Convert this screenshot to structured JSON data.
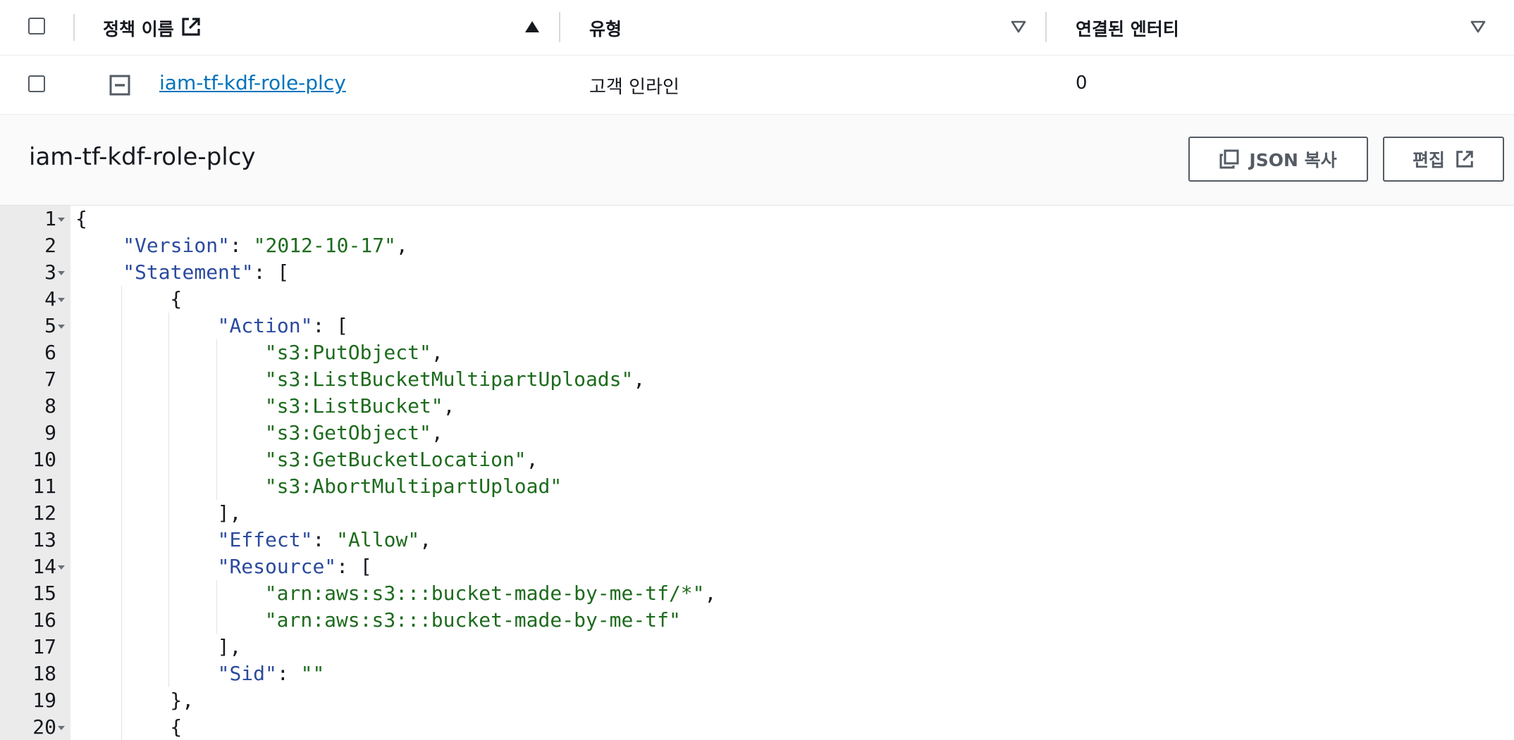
{
  "table": {
    "headers": {
      "policy_name": "정책 이름",
      "type": "유형",
      "attached_entities": "연결된 엔터티"
    },
    "rows": [
      {
        "name": "iam-tf-kdf-role-plcy",
        "type": "고객 인라인",
        "attached": "0"
      }
    ]
  },
  "detail": {
    "title": "iam-tf-kdf-role-plcy",
    "copy_json_label": "JSON 복사",
    "edit_label": "편집"
  },
  "editor": {
    "lines": [
      [
        [
          "p",
          "{"
        ]
      ],
      [
        [
          "k",
          "\"Version\""
        ],
        [
          "p",
          ": "
        ],
        [
          "s",
          "\"2012-10-17\""
        ],
        [
          "p",
          ","
        ]
      ],
      [
        [
          "k",
          "\"Statement\""
        ],
        [
          "p",
          ": ["
        ]
      ],
      [
        [
          "p",
          "{"
        ]
      ],
      [
        [
          "k",
          "\"Action\""
        ],
        [
          "p",
          ": ["
        ]
      ],
      [
        [
          "s",
          "\"s3:PutObject\""
        ],
        [
          "p",
          ","
        ]
      ],
      [
        [
          "s",
          "\"s3:ListBucketMultipartUploads\""
        ],
        [
          "p",
          ","
        ]
      ],
      [
        [
          "s",
          "\"s3:ListBucket\""
        ],
        [
          "p",
          ","
        ]
      ],
      [
        [
          "s",
          "\"s3:GetObject\""
        ],
        [
          "p",
          ","
        ]
      ],
      [
        [
          "s",
          "\"s3:GetBucketLocation\""
        ],
        [
          "p",
          ","
        ]
      ],
      [
        [
          "s",
          "\"s3:AbortMultipartUpload\""
        ]
      ],
      [
        [
          "p",
          "],"
        ]
      ],
      [
        [
          "k",
          "\"Effect\""
        ],
        [
          "p",
          ": "
        ],
        [
          "s",
          "\"Allow\""
        ],
        [
          "p",
          ","
        ]
      ],
      [
        [
          "k",
          "\"Resource\""
        ],
        [
          "p",
          ": ["
        ]
      ],
      [
        [
          "s",
          "\"arn:aws:s3:::bucket-made-by-me-tf/*\""
        ],
        [
          "p",
          ","
        ]
      ],
      [
        [
          "s",
          "\"arn:aws:s3:::bucket-made-by-me-tf\""
        ]
      ],
      [
        [
          "p",
          "],"
        ]
      ],
      [
        [
          "k",
          "\"Sid\""
        ],
        [
          "p",
          ": "
        ],
        [
          "s",
          "\"\""
        ]
      ],
      [
        [
          "p",
          "},"
        ]
      ],
      [
        [
          "p",
          "{"
        ]
      ]
    ]
  }
}
